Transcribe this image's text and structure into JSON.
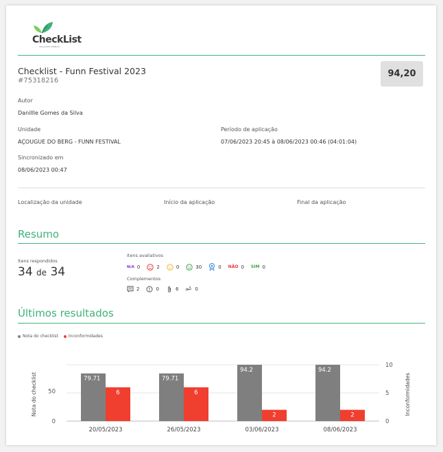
{
  "logo": {
    "text": "CheckList",
    "subtext": "SOLUÇÕES SIMPLES"
  },
  "checklist": {
    "title": "Checklist - Funn Festival 2023",
    "code": "#75318216",
    "score": "94,20"
  },
  "author": {
    "label": "Autor",
    "value": "Danillle Gomes da Silva"
  },
  "unit": {
    "label": "Unidade",
    "value": "AÇOUGUE DO BERG - FUNN FESTIVAL"
  },
  "period": {
    "label": "Período de aplicação",
    "value": "07/06/2023 20:45 à 08/06/2023 00:46 (04:01:04)"
  },
  "synced": {
    "label": "Sincronizado em",
    "value": "08/06/2023 00:47"
  },
  "location": {
    "unit_location": "Localização da unidade",
    "start": "Início da aplicação",
    "end": "Final da aplicação"
  },
  "summary": {
    "title": "Resumo",
    "answered_label": "Itens respondidos",
    "answered": "34",
    "of": "de",
    "total": "34",
    "evaluative_label": "Itens avaliativos",
    "evaluative": {
      "na_label": "N/A",
      "na": "0",
      "sad": "2",
      "neutral": "0",
      "happy": "30",
      "badge": "0",
      "nao_label": "NÃO",
      "nao": "0",
      "sim_label": "SIM",
      "sim": "0"
    },
    "complements_label": "Complementos",
    "complements": {
      "comments": "2",
      "alerts": "0",
      "attachments": "6",
      "signatures": "0"
    }
  },
  "results": {
    "title": "Últimos resultados"
  },
  "colors": {
    "accent": "#3fb27a",
    "gray_bar": "#7f7f7f",
    "red_bar": "#f03e2f"
  },
  "chart_data": {
    "type": "bar",
    "categories": [
      "20/05/2023",
      "26/05/2023",
      "03/06/2023",
      "08/06/2023"
    ],
    "series": [
      {
        "name": "Nota do checklist",
        "axis": "left",
        "values": [
          79.71,
          79.71,
          94.2,
          94.2
        ]
      },
      {
        "name": "Inconformidades",
        "axis": "right",
        "values": [
          6,
          6,
          2,
          2
        ]
      }
    ],
    "ylabel": "Nota do checklist",
    "y2label": "Inconformidades",
    "ylim": [
      0,
      94.2
    ],
    "y_ticks": [
      0,
      50
    ],
    "y2lim": [
      0,
      10
    ],
    "y2_ticks": [
      0,
      5,
      10
    ],
    "legend": "top-left",
    "grid": true
  }
}
